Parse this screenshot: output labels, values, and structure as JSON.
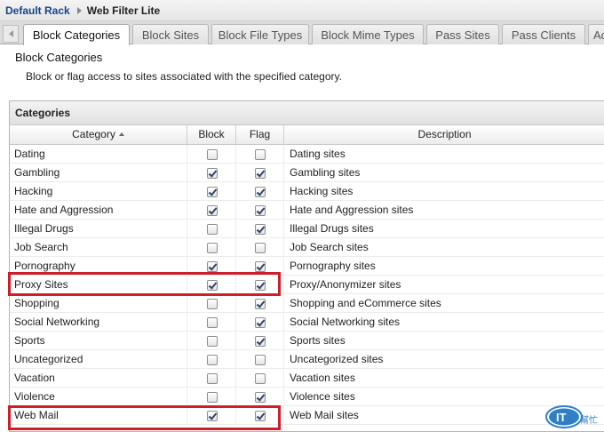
{
  "breadcrumb": {
    "parent": "Default Rack",
    "current": "Web Filter Lite"
  },
  "tabs": [
    {
      "label": "Block Categories",
      "active": true
    },
    {
      "label": "Block Sites",
      "active": false
    },
    {
      "label": "Block File Types",
      "active": false
    },
    {
      "label": "Block Mime Types",
      "active": false
    },
    {
      "label": "Pass Sites",
      "active": false
    },
    {
      "label": "Pass Clients",
      "active": false
    },
    {
      "label": "Ad",
      "active": false
    }
  ],
  "panel": {
    "title": "Block Categories",
    "description": "Block or flag access to sites associated with the specified category."
  },
  "grid": {
    "title": "Categories",
    "columns": {
      "category": "Category",
      "block": "Block",
      "flag": "Flag",
      "description": "Description"
    },
    "sort": {
      "column": "category",
      "direction": "ascending"
    },
    "rows": [
      {
        "category": "Dating",
        "block": false,
        "flag": false,
        "description": "Dating sites"
      },
      {
        "category": "Gambling",
        "block": true,
        "flag": true,
        "description": "Gambling sites"
      },
      {
        "category": "Hacking",
        "block": true,
        "flag": true,
        "description": "Hacking sites"
      },
      {
        "category": "Hate and Aggression",
        "block": true,
        "flag": true,
        "description": "Hate and Aggression sites"
      },
      {
        "category": "Illegal Drugs",
        "block": false,
        "flag": true,
        "description": "Illegal Drugs sites"
      },
      {
        "category": "Job Search",
        "block": false,
        "flag": false,
        "description": "Job Search sites"
      },
      {
        "category": "Pornography",
        "block": true,
        "flag": true,
        "description": "Pornography sites"
      },
      {
        "category": "Proxy Sites",
        "block": true,
        "flag": true,
        "description": "Proxy/Anonymizer sites"
      },
      {
        "category": "Shopping",
        "block": false,
        "flag": true,
        "description": "Shopping and eCommerce sites"
      },
      {
        "category": "Social Networking",
        "block": false,
        "flag": true,
        "description": "Social Networking sites"
      },
      {
        "category": "Sports",
        "block": false,
        "flag": true,
        "description": "Sports sites"
      },
      {
        "category": "Uncategorized",
        "block": false,
        "flag": false,
        "description": "Uncategorized sites"
      },
      {
        "category": "Vacation",
        "block": false,
        "flag": false,
        "description": "Vacation sites"
      },
      {
        "category": "Violence",
        "block": false,
        "flag": true,
        "description": "Violence sites"
      },
      {
        "category": "Web Mail",
        "block": true,
        "flag": true,
        "description": "Web Mail sites"
      }
    ]
  },
  "annotations": {
    "highlight_color": "#cc1f2b",
    "highlighted_rows": [
      "Proxy Sites",
      "Web Mail"
    ]
  },
  "colors": {
    "breadcrumb_link": "#15428b",
    "checkmark": "#30446a"
  },
  "watermark": {
    "text": "IT",
    "subtext": "幫忙"
  }
}
